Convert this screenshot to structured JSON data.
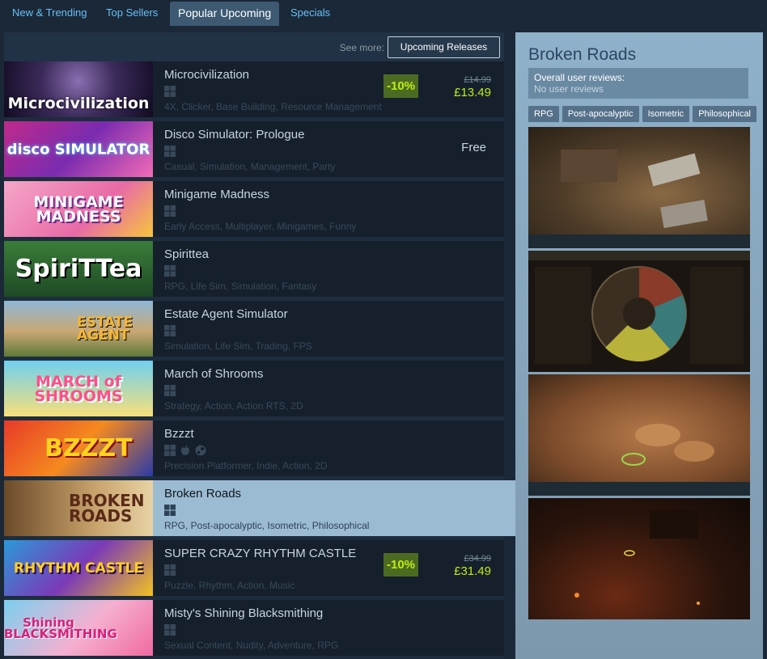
{
  "tabs": [
    {
      "label": "New & Trending"
    },
    {
      "label": "Top Sellers"
    },
    {
      "label": "Popular Upcoming"
    },
    {
      "label": "Specials"
    }
  ],
  "see_more": {
    "label": "See more:",
    "button": "Upcoming Releases"
  },
  "rows": [
    {
      "name": "Microcivilization",
      "capsule": "Microcivilization",
      "platforms": [
        "windows-icon"
      ],
      "tags": "4X, Clicker, Base Building, Resource Management",
      "discount": "-10%",
      "original_price": "£14.99",
      "final_price": "£13.49"
    },
    {
      "name": "Disco Simulator: Prologue",
      "capsule": "disco SIMULATOR",
      "platforms": [
        "windows-icon"
      ],
      "tags": "Casual, Simulation, Management, Party",
      "price": "Free"
    },
    {
      "name": "Minigame Madness",
      "capsule": "MINIGAME MADNESS",
      "platforms": [
        "windows-icon"
      ],
      "tags": "Early Access, Multiplayer, Minigames, Funny"
    },
    {
      "name": "Spirittea",
      "capsule": "SpiriTTea",
      "platforms": [
        "windows-icon"
      ],
      "tags": "RPG, Life Sim, Simulation, Fantasy"
    },
    {
      "name": "Estate Agent Simulator",
      "capsule": "ESTATE AGENT",
      "platforms": [
        "windows-icon"
      ],
      "tags": "Simulation, Life Sim, Trading, FPS"
    },
    {
      "name": "March of Shrooms",
      "capsule": "MARCH of SHROOMS",
      "platforms": [
        "windows-icon"
      ],
      "tags": "Strategy, Action, Action RTS, 2D"
    },
    {
      "name": "Bzzzt",
      "capsule": "BZZZT",
      "platforms": [
        "windows-icon",
        "apple-icon",
        "steam-icon"
      ],
      "tags": "Precision Platformer, Indie, Action, 2D"
    },
    {
      "name": "Broken Roads",
      "capsule": "BROKEN ROADS",
      "platforms": [
        "windows-icon"
      ],
      "tags": "RPG, Post-apocalyptic, Isometric, Philosophical"
    },
    {
      "name": "SUPER CRAZY RHYTHM CASTLE",
      "capsule": "RHYTHM CASTLE",
      "platforms": [
        "windows-icon"
      ],
      "tags": "Puzzle, Rhythm, Action, Music",
      "discount": "-10%",
      "original_price": "£34.99",
      "final_price": "£31.49"
    },
    {
      "name": "Misty's Shining Blacksmithing",
      "capsule": "Shining BLACKSMITHING",
      "platforms": [
        "windows-icon"
      ],
      "tags": "Sexual Content, Nudity, Adventure, RPG"
    }
  ],
  "preview": {
    "title": "Broken Roads",
    "reviews_label": "Overall user reviews:",
    "reviews_value": "No user reviews",
    "tags": [
      "RPG",
      "Post-apocalyptic",
      "Isometric",
      "Philosophical"
    ]
  },
  "colors": {
    "background": "#1b2838",
    "accent": "#66c0f4",
    "discount_bg": "#4c6b22",
    "discount_text": "#beee11",
    "hover_row": "#9bbbd3"
  }
}
